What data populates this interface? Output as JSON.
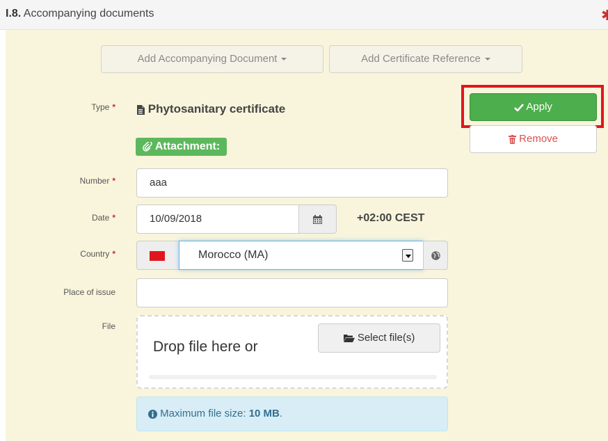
{
  "header": {
    "section_number": "I.8.",
    "section_title": " Accompanying documents"
  },
  "toolbar": {
    "add_document_label": "Add Accompanying Document",
    "add_reference_label": "Add Certificate Reference"
  },
  "actions": {
    "apply_label": "Apply",
    "remove_label": "Remove"
  },
  "form": {
    "type_label": "Type",
    "type_value": "Phytosanitary certificate",
    "attachment_badge": "Attachment:",
    "number_label": "Number",
    "number_value": "aaa",
    "date_label": "Date",
    "date_value": "10/09/2018",
    "timezone": "+02:00 CEST",
    "country_label": "Country",
    "country_value": "Morocco (MA)",
    "place_label": "Place of issue",
    "place_value": "",
    "file_label": "File",
    "drop_text": "Drop file here or",
    "select_files_label": "Select file(s)",
    "max_size_text": "Maximum file size: ",
    "max_size_value": "10 MB",
    "max_size_suffix": ".",
    "required_mark": "*"
  },
  "colors": {
    "panel_bg": "#f8f5dc",
    "apply_green": "#4cae4c",
    "highlight_red": "#e0161e",
    "remove_red": "#d9534f",
    "info_bg": "#d9edf7"
  },
  "icons": {
    "type": "document-icon",
    "attachment": "paperclip-icon",
    "apply": "check-icon",
    "remove": "trash-icon",
    "calendar": "calendar-icon",
    "globe": "globe-icon",
    "folder": "folder-open-icon",
    "info": "info-circle-icon"
  }
}
